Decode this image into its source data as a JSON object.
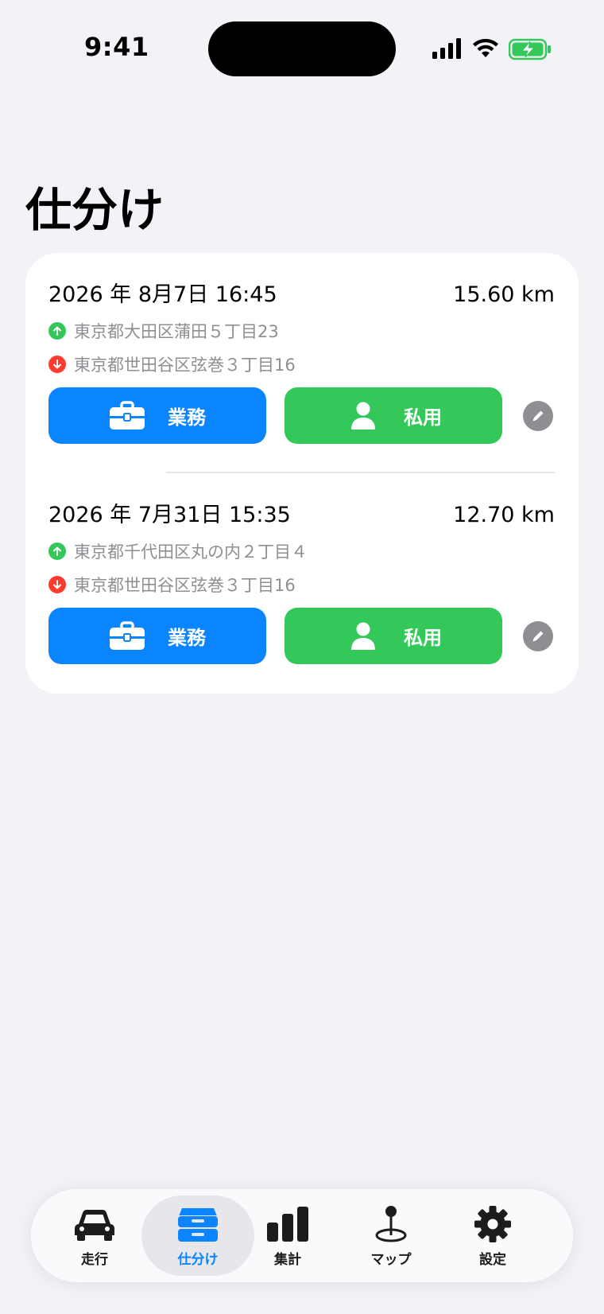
{
  "status_bar": {
    "time": "9:41"
  },
  "page_title": "仕分け",
  "trips": [
    {
      "datetime": "2026 年 8月7日 16:45",
      "distance": "15.60 km",
      "start_address": "東京都大田区蒲田５丁目23",
      "end_address": "東京都世田谷区弦巻３丁目16"
    },
    {
      "datetime": "2026 年 7月31日 15:35",
      "distance": "12.70 km",
      "start_address": "東京都千代田区丸の内２丁目４",
      "end_address": "東京都世田谷区弦巻３丁目16"
    }
  ],
  "buttons": {
    "business": "業務",
    "private": "私用"
  },
  "tabs": [
    {
      "label": "走行",
      "icon": "car-icon"
    },
    {
      "label": "仕分け",
      "icon": "tray-icon",
      "active": true
    },
    {
      "label": "集計",
      "icon": "bar-chart-icon"
    },
    {
      "label": "マップ",
      "icon": "map-pin-icon"
    },
    {
      "label": "設定",
      "icon": "gear-icon"
    }
  ],
  "colors": {
    "business": "#0a84ff",
    "private": "#34c759",
    "start_dot": "#34c759",
    "end_dot": "#ff3b30",
    "active_tab": "#0a84ff"
  }
}
